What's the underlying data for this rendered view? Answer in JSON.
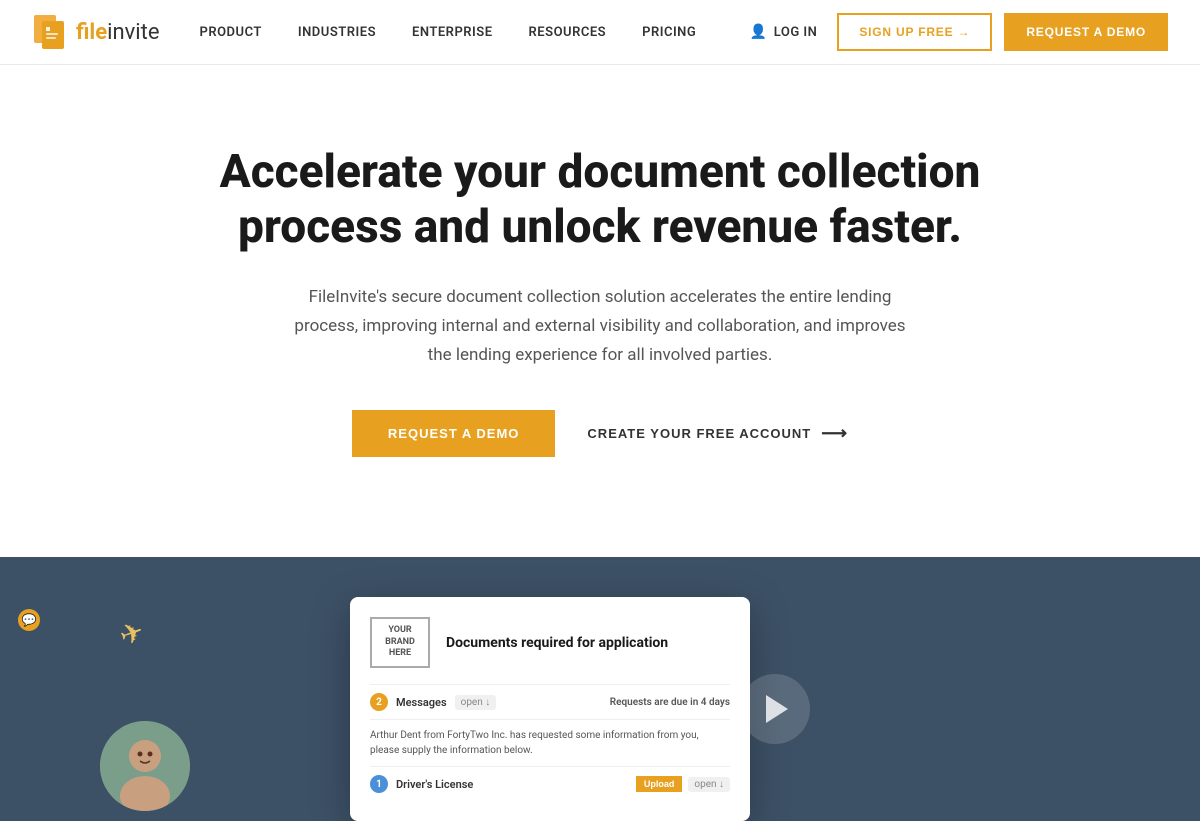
{
  "navbar": {
    "logo_file": "file",
    "logo_invite": "invite",
    "nav_items": [
      {
        "label": "PRODUCT",
        "id": "product"
      },
      {
        "label": "INDUSTRIES",
        "id": "industries"
      },
      {
        "label": "ENTERPRISE",
        "id": "enterprise"
      },
      {
        "label": "RESOURCES",
        "id": "resources"
      },
      {
        "label": "PRICING",
        "id": "pricing"
      }
    ],
    "login_label": "LOG IN",
    "signup_label": "SIGN UP FREE →",
    "demo_label": "REQUEST A DEMO"
  },
  "hero": {
    "title": "Accelerate your document collection process and unlock revenue faster.",
    "subtitle": "FileInvite's secure document collection solution accelerates the entire lending process, improving internal and external visibility and collaboration, and improves the lending experience for all involved parties.",
    "cta_primary": "REQUEST A DEMO",
    "cta_secondary": "CREATE YOUR FREE ACCOUNT",
    "arrow": "⟶"
  },
  "preview": {
    "brand_line1": "YOUR",
    "brand_line2": "BRAND",
    "brand_line3": "HERE",
    "card_title": "Documents required for application",
    "row1_num": "2",
    "row1_label": "Messages",
    "row1_tag": "open ↓",
    "row1_due": "Requests are due in 4 days",
    "message_text": "Arthur Dent from FortyTwo Inc. has requested some information from you, please supply the information below.",
    "row2_num": "1",
    "row2_label": "Driver's License",
    "row2_tag": "open ↓",
    "upload_label": "Upload"
  },
  "chat": {
    "icon": "💬"
  }
}
